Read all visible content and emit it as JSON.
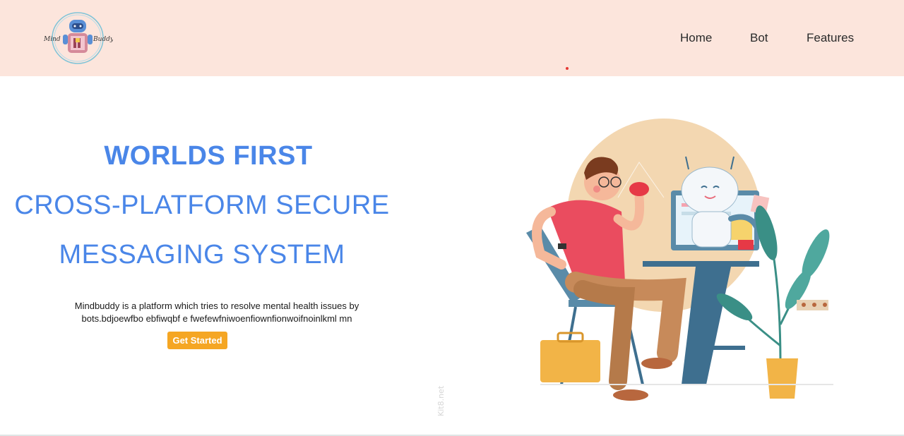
{
  "brand": {
    "logo_alt": "Mind Buddy",
    "logo_text_left": "Mind",
    "logo_text_right": "Buddy"
  },
  "nav": {
    "items": [
      {
        "label": "Home"
      },
      {
        "label": "Bot"
      },
      {
        "label": "Features"
      }
    ]
  },
  "hero": {
    "line1": "WORLDS FIRST",
    "line2": "CROSS-PLATFORM SECURE",
    "line3": "MESSAGING SYSTEM",
    "description_line1": "Mindbuddy is a platform which tries to resolve mental health issues by",
    "description_line2": "bots.bdjoewfbo ebfiwqbf e fwefewfniwoenfiownfionwoifnoinlkml mn",
    "cta_label": "Get Started"
  },
  "illustration": {
    "watermark": "Kit8.net"
  },
  "colors": {
    "navbar_bg": "#fce5dc",
    "heading_blue": "#4a86e8",
    "cta_orange": "#f5a623"
  }
}
